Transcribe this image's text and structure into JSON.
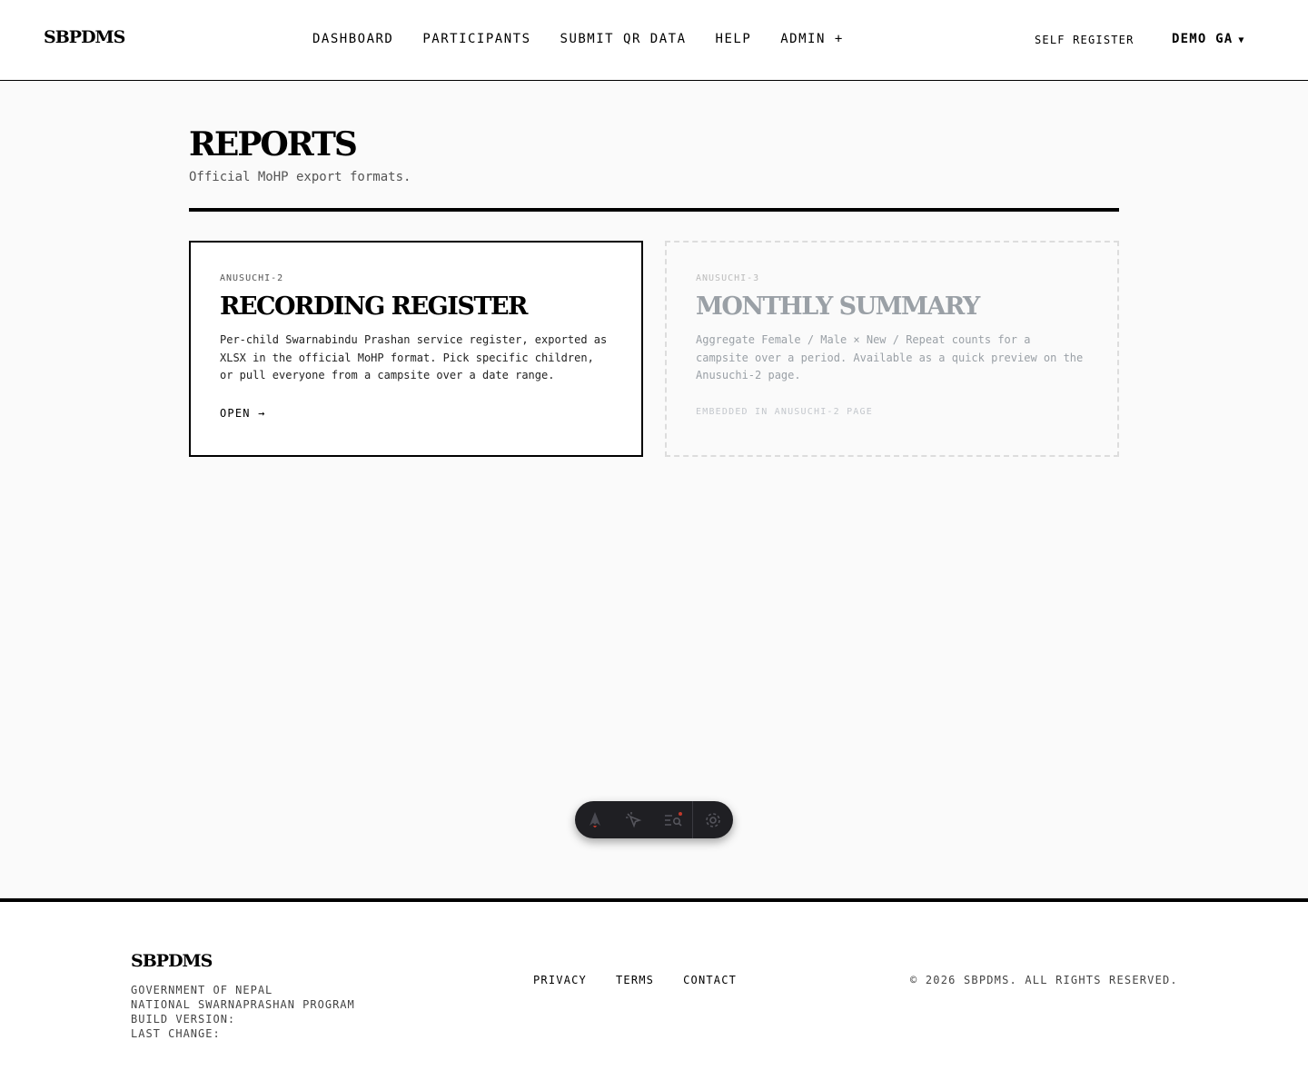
{
  "header": {
    "logo": "SBPDMS",
    "nav": [
      {
        "label": "DASHBOARD"
      },
      {
        "label": "PARTICIPANTS"
      },
      {
        "label": "SUBMIT QR DATA"
      },
      {
        "label": "HELP"
      },
      {
        "label": "ADMIN +"
      }
    ],
    "self_register": "SELF REGISTER",
    "user_name": "DEMO GA",
    "user_caret": "▼"
  },
  "main": {
    "title": "REPORTS",
    "subtitle": "Official MoHP export formats.",
    "cards": [
      {
        "tag": "ANUSUCHI-2",
        "title": "RECORDING REGISTER",
        "description": "Per-child Swarnabindu Prashan service register, exported as XLSX in the official MoHP format. Pick specific children, or pull everyone from a campsite over a date range.",
        "action": "OPEN →"
      },
      {
        "tag": "ANUSUCHI-3",
        "title": "MONTHLY SUMMARY",
        "description": "Aggregate Female / Male × New / Repeat counts for a campsite over a period. Available as a quick preview on the Anusuchi-2 page.",
        "action": "EMBEDDED IN ANUSUCHI-2 PAGE"
      }
    ]
  },
  "toolbar": {
    "icons": [
      "astro-logo-icon",
      "cursor-select-icon",
      "audit-list-icon",
      "settings-gear-icon"
    ]
  },
  "footer": {
    "logo": "SBPDMS",
    "org_line": "GOVERNMENT OF NEPAL",
    "program_line": "NATIONAL SWARNAPRASHAN PROGRAM",
    "build_line": "BUILD VERSION:",
    "change_line": "LAST CHANGE:",
    "links": [
      {
        "label": "PRIVACY"
      },
      {
        "label": "TERMS"
      },
      {
        "label": "CONTACT"
      }
    ],
    "copyright": "© 2026 SBPDMS. ALL RIGHTS RESERVED."
  },
  "colors": {
    "background": "#fafafa",
    "text": "#000000",
    "muted": "#9aa0a6",
    "toolbar": "#1f1f23"
  }
}
